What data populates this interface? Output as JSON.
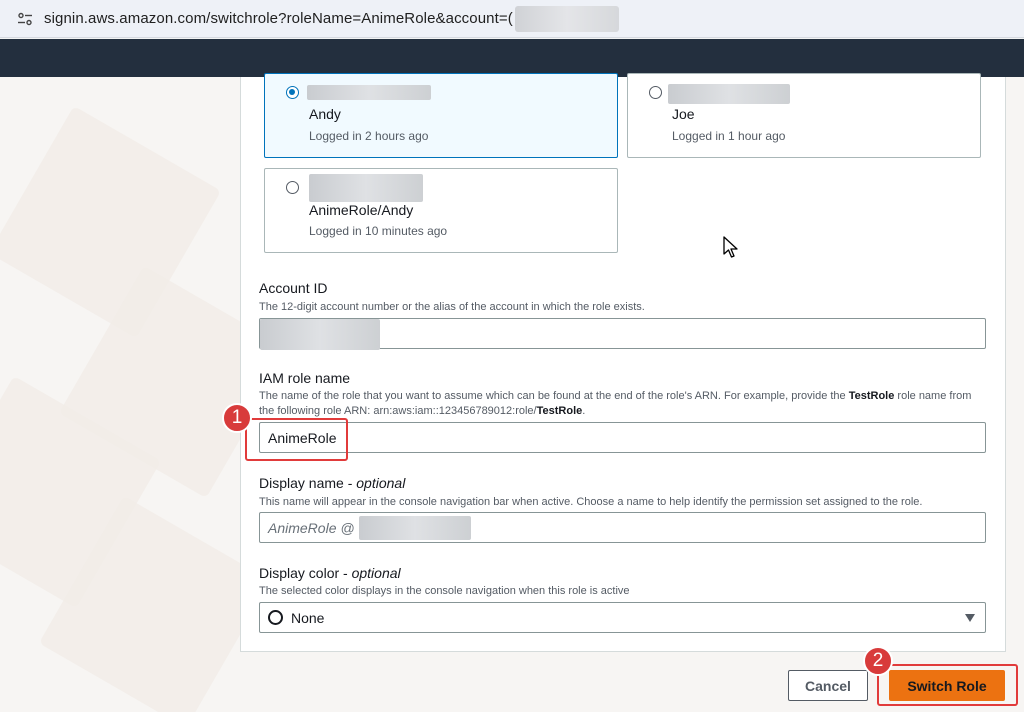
{
  "browser": {
    "url": "signin.aws.amazon.com/switchrole?roleName=AnimeRole&account=("
  },
  "roles": [
    {
      "name": "Andy",
      "time": "Logged in 2 hours ago",
      "selected": true
    },
    {
      "name": "Joe",
      "time": "Logged in 1 hour ago",
      "selected": false
    },
    {
      "name": "AnimeRole/Andy",
      "time": "Logged in 10 minutes ago",
      "selected": false
    }
  ],
  "account_id": {
    "label": "Account ID",
    "description": "The 12-digit account number or the alias of the account in which the role exists."
  },
  "iam_role": {
    "label": "IAM role name",
    "desc_part1": "The name of the role that you want to assume which can be found at the end of the role's ARN. For example, provide the ",
    "desc_bold1": "TestRole",
    "desc_part2": " role name from the following role ARN: arn:aws:iam::123456789012:role/",
    "desc_bold2": "TestRole",
    "desc_part3": ".",
    "value": "AnimeRole"
  },
  "display_name": {
    "label": "Display name - ",
    "label_optional": "optional",
    "description": "This name will appear in the console navigation bar when active. Choose a name to help identify the permission set assigned to the role.",
    "placeholder": "AnimeRole @"
  },
  "display_color": {
    "label": "Display color - ",
    "label_optional": "optional",
    "description": "The selected color displays in the console navigation when this role is active",
    "value": "None"
  },
  "buttons": {
    "cancel": "Cancel",
    "switch_role": "Switch Role"
  },
  "annotations": [
    "1",
    "2"
  ],
  "colors": {
    "nav": "#232f3e",
    "primary": "#ec7211",
    "selected_border": "#0073bb",
    "highlight": "#e13b3b"
  }
}
